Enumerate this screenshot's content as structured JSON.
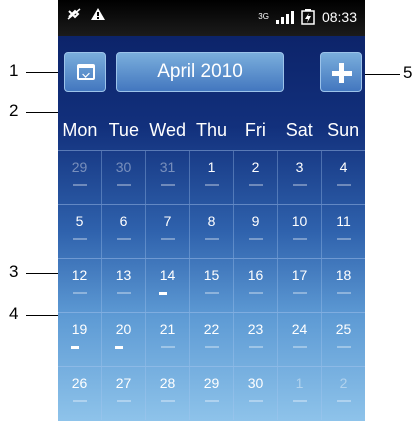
{
  "status_bar": {
    "icons": [
      "bluetooth-off-icon",
      "warning-icon",
      "3g-icon",
      "signal-icon",
      "battery-charging-icon"
    ],
    "network": "3G",
    "time": "08:33"
  },
  "header": {
    "month_label": "April 2010",
    "today_button_icon": "calendar-today-icon",
    "add_button_icon": "plus-icon"
  },
  "weekdays": [
    "Mon",
    "Tue",
    "Wed",
    "Thu",
    "Fri",
    "Sat",
    "Sun"
  ],
  "weeks": [
    [
      {
        "day": "29",
        "current": false,
        "event": false
      },
      {
        "day": "30",
        "current": false,
        "event": false
      },
      {
        "day": "31",
        "current": false,
        "event": false
      },
      {
        "day": "1",
        "current": true,
        "event": false
      },
      {
        "day": "2",
        "current": true,
        "event": false
      },
      {
        "day": "3",
        "current": true,
        "event": false
      },
      {
        "day": "4",
        "current": true,
        "event": false
      }
    ],
    [
      {
        "day": "5",
        "current": true,
        "event": false
      },
      {
        "day": "6",
        "current": true,
        "event": false
      },
      {
        "day": "7",
        "current": true,
        "event": false
      },
      {
        "day": "8",
        "current": true,
        "event": false
      },
      {
        "day": "9",
        "current": true,
        "event": false
      },
      {
        "day": "10",
        "current": true,
        "event": false
      },
      {
        "day": "11",
        "current": true,
        "event": false
      }
    ],
    [
      {
        "day": "12",
        "current": true,
        "event": false
      },
      {
        "day": "13",
        "current": true,
        "event": false
      },
      {
        "day": "14",
        "current": true,
        "event": true
      },
      {
        "day": "15",
        "current": true,
        "event": false
      },
      {
        "day": "16",
        "current": true,
        "event": false
      },
      {
        "day": "17",
        "current": true,
        "event": false
      },
      {
        "day": "18",
        "current": true,
        "event": false
      }
    ],
    [
      {
        "day": "19",
        "current": true,
        "event": true
      },
      {
        "day": "20",
        "current": true,
        "event": true
      },
      {
        "day": "21",
        "current": true,
        "event": false
      },
      {
        "day": "22",
        "current": true,
        "event": false
      },
      {
        "day": "23",
        "current": true,
        "event": false
      },
      {
        "day": "24",
        "current": true,
        "event": false
      },
      {
        "day": "25",
        "current": true,
        "event": false
      }
    ],
    [
      {
        "day": "26",
        "current": true,
        "event": false
      },
      {
        "day": "27",
        "current": true,
        "event": false
      },
      {
        "day": "28",
        "current": true,
        "event": false
      },
      {
        "day": "29",
        "current": true,
        "event": false
      },
      {
        "day": "30",
        "current": true,
        "event": false
      },
      {
        "day": "1",
        "current": false,
        "event": false
      },
      {
        "day": "2",
        "current": false,
        "event": false
      }
    ]
  ],
  "callouts": [
    "1",
    "2",
    "3",
    "4",
    "5"
  ],
  "colors": {
    "screen_top": "#0a1f63",
    "screen_bottom": "#8ec3ea",
    "button": "#4377bf"
  }
}
